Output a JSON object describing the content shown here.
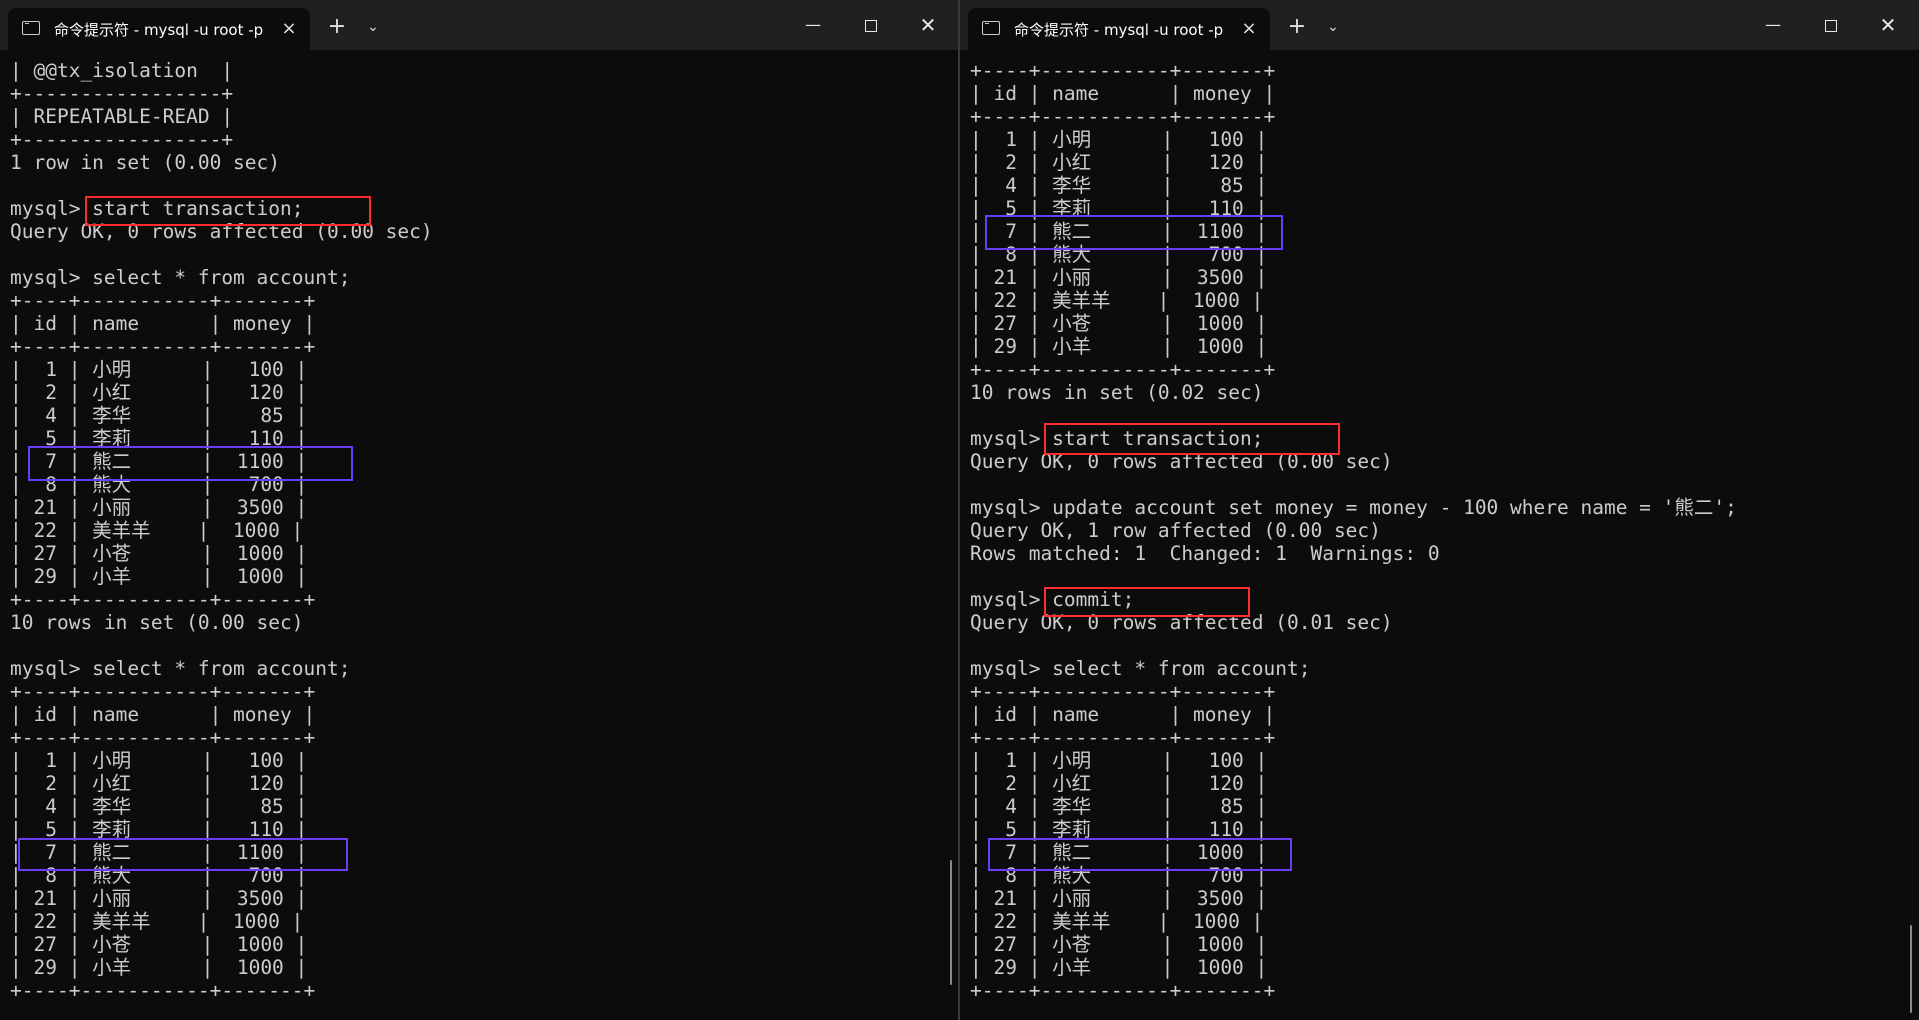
{
  "colors": {
    "terminal_bg": "#0c0c0c",
    "titlebar_bg": "#202020",
    "text": "#cccccc",
    "highlight_red": "#ff2d2d",
    "highlight_blue": "#6a3df6"
  },
  "left": {
    "tab_title": "命令提示符 - mysql  -u root -p",
    "tab_icon": "terminal-icon",
    "lines": [
      "| @@tx_isolation  |",
      "+-----------------+",
      "| REPEATABLE-READ |",
      "+-----------------+",
      "1 row in set (0.00 sec)",
      "",
      "mysql> start transaction;",
      "Query OK, 0 rows affected (0.00 sec)",
      "",
      "mysql> select * from account;",
      "+----+-----------+-------+",
      "| id | name      | money |",
      "+----+-----------+-------+",
      "|  1 | 小明      |   100 |",
      "|  2 | 小红      |   120 |",
      "|  4 | 李华      |    85 |",
      "|  5 | 李莉      |   110 |",
      "|  7 | 熊二      |  1100 |",
      "|  8 | 熊大      |   700 |",
      "| 21 | 小丽      |  3500 |",
      "| 22 | 美羊羊    |  1000 |",
      "| 27 | 小苍      |  1000 |",
      "| 29 | 小羊      |  1000 |",
      "+----+-----------+-------+",
      "10 rows in set (0.00 sec)",
      "",
      "mysql> select * from account;",
      "+----+-----------+-------+",
      "| id | name      | money |",
      "+----+-----------+-------+",
      "|  1 | 小明      |   100 |",
      "|  2 | 小红      |   120 |",
      "|  4 | 李华      |    85 |",
      "|  5 | 李莉      |   110 |",
      "|  7 | 熊二      |  1100 |",
      "|  8 | 熊大      |   700 |",
      "| 21 | 小丽      |  3500 |",
      "| 22 | 美羊羊    |  1000 |",
      "| 27 | 小苍      |  1000 |",
      "| 29 | 小羊      |  1000 |",
      "+----+-----------+-------+"
    ]
  },
  "right": {
    "tab_title": "命令提示符 - mysql  -u root -p",
    "tab_icon": "terminal-icon",
    "lines": [
      "+----+-----------+-------+",
      "| id | name      | money |",
      "+----+-----------+-------+",
      "|  1 | 小明      |   100 |",
      "|  2 | 小红      |   120 |",
      "|  4 | 李华      |    85 |",
      "|  5 | 李莉      |   110 |",
      "|  7 | 熊二      |  1100 |",
      "|  8 | 熊大      |   700 |",
      "| 21 | 小丽      |  3500 |",
      "| 22 | 美羊羊    |  1000 |",
      "| 27 | 小苍      |  1000 |",
      "| 29 | 小羊      |  1000 |",
      "+----+-----------+-------+",
      "10 rows in set (0.02 sec)",
      "",
      "mysql> start transaction;",
      "Query OK, 0 rows affected (0.00 sec)",
      "",
      "mysql> update account set money = money - 100 where name = '熊二';",
      "Query OK, 1 row affected (0.00 sec)",
      "Rows matched: 1  Changed: 1  Warnings: 0",
      "",
      "mysql> commit;",
      "Query OK, 0 rows affected (0.01 sec)",
      "",
      "mysql> select * from account;",
      "+----+-----------+-------+",
      "| id | name      | money |",
      "+----+-----------+-------+",
      "|  1 | 小明      |   100 |",
      "|  2 | 小红      |   120 |",
      "|  4 | 李华      |    85 |",
      "|  5 | 李莉      |   110 |",
      "|  7 | 熊二      |  1000 |",
      "|  8 | 熊大      |   700 |",
      "| 21 | 小丽      |  3500 |",
      "| 22 | 美羊羊    |  1000 |",
      "| 27 | 小苍      |  1000 |",
      "| 29 | 小羊      |  1000 |",
      "+----+-----------+-------+"
    ]
  },
  "controls": {
    "tab_close_glyph": "×",
    "new_tab_glyph": "+",
    "dropdown_glyph": "⌄",
    "minimize_glyph": "—",
    "close_glyph": "✕"
  }
}
